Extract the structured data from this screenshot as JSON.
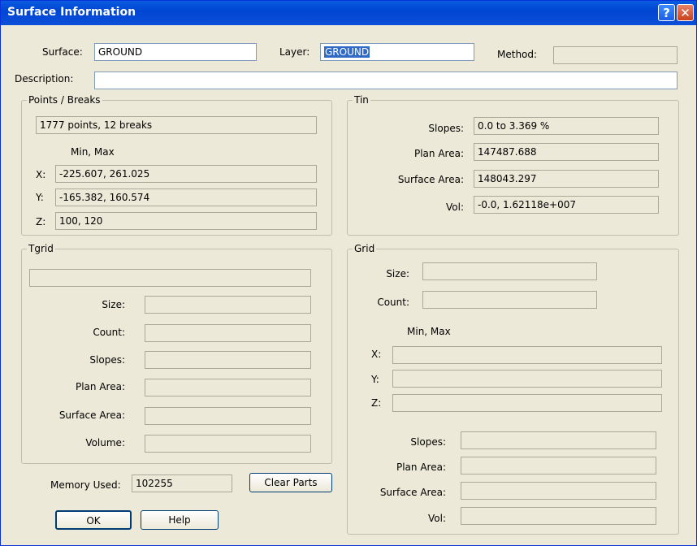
{
  "window": {
    "title": "Surface Information",
    "help_glyph": "?",
    "close_glyph": "✕"
  },
  "header": {
    "surface_label": "Surface:",
    "surface_value": "GROUND",
    "layer_label": "Layer:",
    "layer_value": "GROUND",
    "method_label": "Method:",
    "method_value": "",
    "description_label": "Description:",
    "description_value": ""
  },
  "points": {
    "title": "Points / Breaks",
    "summary": "1777 points, 12 breaks",
    "minmax_label": "Min,  Max",
    "x_label": "X:",
    "x_value": "-225.607, 261.025",
    "y_label": "Y:",
    "y_value": "-165.382, 160.574",
    "z_label": "Z:",
    "z_value": "100, 120"
  },
  "tin": {
    "title": "Tin",
    "slopes_label": "Slopes:",
    "slopes_value": "0.0 to 3.369 %",
    "plan_label": "Plan Area:",
    "plan_value": "147487.688",
    "surface_label": "Surface Area:",
    "surface_value": "148043.297",
    "vol_label": "Vol:",
    "vol_value": "-0.0, 1.62118e+007"
  },
  "tgrid": {
    "title": "Tgrid",
    "top_value": "",
    "size_label": "Size:",
    "count_label": "Count:",
    "slopes_label": "Slopes:",
    "plan_label": "Plan Area:",
    "surface_label": "Surface Area:",
    "volume_label": "Volume:"
  },
  "grid": {
    "title": "Grid",
    "size_label": "Size:",
    "count_label": "Count:",
    "minmax_label": "Min,  Max",
    "x_label": "X:",
    "y_label": "Y:",
    "z_label": "Z:",
    "slopes_label": "Slopes:",
    "plan_label": "Plan Area:",
    "surface_label": "Surface Area:",
    "vol_label": "Vol:"
  },
  "memory": {
    "label": "Memory Used:",
    "value": "102255"
  },
  "buttons": {
    "clear_parts": "Clear Parts",
    "ok": "OK",
    "help": "Help"
  }
}
